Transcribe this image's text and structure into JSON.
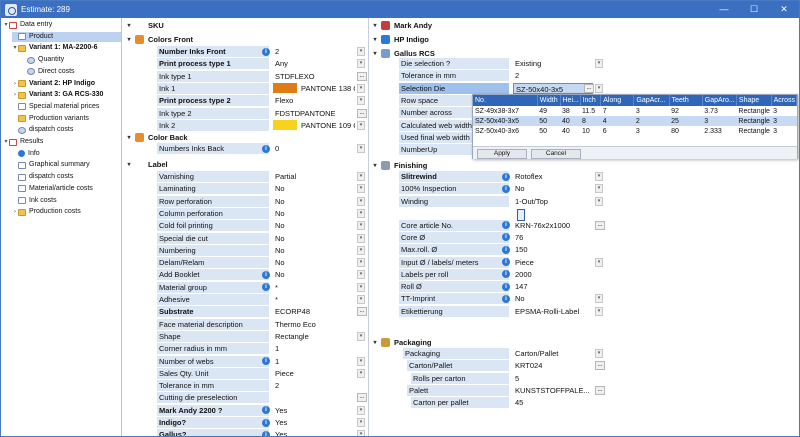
{
  "window": {
    "title": "Estimate: 289",
    "controls": [
      "—",
      "☐",
      "✕"
    ]
  },
  "tree": [
    {
      "label": "Data entry",
      "indent": 0,
      "icon": "grid",
      "exp": "▾",
      "bold": false
    },
    {
      "label": "Product",
      "indent": 1,
      "icon": "doc",
      "exp": "",
      "bold": false,
      "sel": true
    },
    {
      "label": "Variant 1: MA-2200-6",
      "indent": 1,
      "icon": "folder",
      "exp": "▾",
      "bold": true
    },
    {
      "label": "Quantity",
      "indent": 2,
      "icon": "cog",
      "exp": "",
      "bold": false
    },
    {
      "label": "Direct costs",
      "indent": 2,
      "icon": "cog",
      "exp": "",
      "bold": false
    },
    {
      "label": "Variant 2: HP Indigo",
      "indent": 1,
      "icon": "folder",
      "exp": "›",
      "bold": true
    },
    {
      "label": "Variant 3: GA RCS-330",
      "indent": 1,
      "icon": "folder",
      "exp": "›",
      "bold": true
    },
    {
      "label": "Special material prices",
      "indent": 1,
      "icon": "doc",
      "exp": "",
      "bold": false
    },
    {
      "label": "Production variants",
      "indent": 1,
      "icon": "folder",
      "exp": "",
      "bold": false
    },
    {
      "label": "dispatch costs",
      "indent": 1,
      "icon": "cog",
      "exp": "",
      "bold": false
    },
    {
      "label": "Results",
      "indent": 0,
      "icon": "grid",
      "exp": "▾",
      "bold": false
    },
    {
      "label": "Info",
      "indent": 1,
      "icon": "info",
      "exp": "",
      "bold": false
    },
    {
      "label": "Graphical summary",
      "indent": 1,
      "icon": "doc",
      "exp": "",
      "bold": false
    },
    {
      "label": "dispatch costs",
      "indent": 1,
      "icon": "doc",
      "exp": "",
      "bold": false
    },
    {
      "label": "Material/article costs",
      "indent": 1,
      "icon": "doc",
      "exp": "",
      "bold": false
    },
    {
      "label": "Ink costs",
      "indent": 1,
      "icon": "doc",
      "exp": "",
      "bold": false
    },
    {
      "label": "Production costs",
      "indent": 1,
      "icon": "folder",
      "exp": "›",
      "bold": false
    }
  ],
  "middle": {
    "sku_header": "SKU",
    "colors_front_header": "Colors Front",
    "colors_front": [
      {
        "label": "Number Inks Front",
        "value": "2",
        "bold": true,
        "info": true,
        "dd": true
      },
      {
        "label": "Print process type 1",
        "value": "Any",
        "bold": true,
        "info": false,
        "dd": true
      },
      {
        "label": "Ink type 1",
        "value": "STDFLEXO",
        "bold": false,
        "info": false,
        "dots": true
      },
      {
        "label": "Ink 1",
        "value": "PANTONE 138 C",
        "bold": false,
        "info": false,
        "dd": true,
        "swatch": "#e07c16"
      },
      {
        "label": "Print process type 2",
        "value": "Flexo",
        "bold": true,
        "info": false,
        "dd": true
      },
      {
        "label": "Ink type 2",
        "value": "FDSTDPANTONE",
        "bold": false,
        "info": false,
        "dots": true
      },
      {
        "label": "Ink 2",
        "value": "PANTONE 109 C",
        "bold": false,
        "info": false,
        "dd": true,
        "swatch": "#f7d31e"
      }
    ],
    "color_back_header": "Color Back",
    "color_back": [
      {
        "label": "Numbers Inks Back",
        "value": "0",
        "bold": false,
        "info": true,
        "dd": true
      }
    ],
    "label_header": "Label",
    "label": [
      {
        "label": "Varnishing",
        "value": "Partial",
        "bold": false,
        "info": false,
        "dd": true
      },
      {
        "label": "Laminating",
        "value": "No",
        "bold": false,
        "info": false,
        "dd": true
      },
      {
        "label": "Row perforation",
        "value": "No",
        "bold": false,
        "info": false,
        "dd": true
      },
      {
        "label": "Column perforation",
        "value": "No",
        "bold": false,
        "info": false,
        "dd": true
      },
      {
        "label": "Cold foil printing",
        "value": "No",
        "bold": false,
        "info": false,
        "dd": true
      },
      {
        "label": "Special die cut",
        "value": "No",
        "bold": false,
        "info": false,
        "dd": true
      },
      {
        "label": "Numbering",
        "value": "No",
        "bold": false,
        "info": false,
        "dd": true
      },
      {
        "label": "Delam/Relam",
        "value": "No",
        "bold": false,
        "info": false,
        "dd": true
      },
      {
        "label": "Add Booklet",
        "value": "No",
        "bold": false,
        "info": true,
        "dd": true
      },
      {
        "label": "Material group",
        "value": "*",
        "bold": false,
        "info": true,
        "dd": true
      },
      {
        "label": "Adhesive",
        "value": "*",
        "bold": false,
        "info": false,
        "dd": true
      },
      {
        "label": "Substrate",
        "value": "ECORP48",
        "bold": true,
        "info": false,
        "dots": true
      },
      {
        "label": "Face material description",
        "value": "Thermo Eco",
        "bold": false,
        "info": false
      },
      {
        "label": "Shape",
        "value": "Rectangle",
        "bold": false,
        "info": false,
        "dd": true
      },
      {
        "label": "Corner radius in mm",
        "value": "1",
        "bold": false,
        "info": false
      },
      {
        "label": "Number of webs",
        "value": "1",
        "bold": false,
        "info": true,
        "dd": true
      },
      {
        "label": "Sales Qty. Unit",
        "value": "Piece",
        "bold": false,
        "info": false,
        "dd": true
      },
      {
        "label": "Tolerance in mm",
        "value": "2",
        "bold": false,
        "info": false
      },
      {
        "label": "Cutting die preselection",
        "value": "",
        "bold": false,
        "info": false,
        "dots": true
      },
      {
        "label": "Mark Andy 2200 ?",
        "value": "Yes",
        "bold": true,
        "info": true,
        "dd": true
      },
      {
        "label": "Indigo?",
        "value": "Yes",
        "bold": true,
        "info": true,
        "dd": true
      },
      {
        "label": "Gallus?",
        "value": "Yes",
        "bold": true,
        "info": true,
        "dd": true
      }
    ]
  },
  "right": {
    "mark_andy": "Mark Andy",
    "hp_indigo": "HP Indigo",
    "gallus": "Gallus RCS",
    "gallus_rows": [
      {
        "label": "Die selection ?",
        "value": "Existing",
        "info": false,
        "dd": true,
        "hl": false
      },
      {
        "label": "Tolerance in mm",
        "value": "2",
        "info": false,
        "hl": false
      },
      {
        "label": "Selection Die",
        "value": "SZ-50x40-3x5",
        "info": false,
        "dd": true,
        "dots": true,
        "hl": true
      },
      {
        "label": "Row space",
        "value": "",
        "info": false,
        "hl": false
      },
      {
        "label": "Number across",
        "value": "",
        "info": false,
        "hl": false
      },
      {
        "label": "Calculated web width",
        "value": "",
        "info": false,
        "hl": false
      },
      {
        "label": "Used final web width",
        "value": "",
        "info": false,
        "hl": false
      },
      {
        "label": "NumberUp",
        "value": "",
        "info": false,
        "hl": false
      }
    ],
    "finishing": "Finishing",
    "finishing_rows": [
      {
        "label": "Slitrewind",
        "value": "Rotoflex",
        "bold": true,
        "info": true,
        "dd": true
      },
      {
        "label": "100% Inspection",
        "value": "No",
        "info": true,
        "dd": true
      },
      {
        "label": "Winding",
        "value": "1-Out/Top",
        "info": false,
        "dd": true,
        "tall": true
      },
      {
        "label": "Core article No.",
        "value": "KRN-76x2x1000",
        "info": true,
        "dots": true
      },
      {
        "label": "Core Ø",
        "value": "76",
        "info": true
      },
      {
        "label": "Max.roll. Ø",
        "value": "150",
        "info": true
      },
      {
        "label": "Input Ø / labels/ meters",
        "value": "Piece",
        "info": true,
        "dd": true
      },
      {
        "label": "Labels per roll",
        "value": "2000",
        "info": true
      },
      {
        "label": "Roll Ø",
        "value": "147",
        "info": true
      },
      {
        "label": "TT-Imprint",
        "value": "No",
        "info": true,
        "dd": true
      },
      {
        "label": "Etikettierung",
        "value": "EPSMA-Rolli-Label",
        "info": false,
        "dd": true
      }
    ],
    "packaging": "Packaging",
    "packaging_rows": [
      {
        "label": "Packaging",
        "value": "Carton/Pallet",
        "indent": 1,
        "dd": true
      },
      {
        "label": "Carton/Pallet",
        "value": "KRT024",
        "indent": 2,
        "dots": true
      },
      {
        "label": "Rolls per carton",
        "value": "5",
        "indent": 3
      },
      {
        "label": "Palett",
        "value": "KUNSTSTOFFPALE...",
        "indent": 2,
        "dots": true
      },
      {
        "label": "Carton per pallet",
        "value": "45",
        "indent": 3
      }
    ]
  },
  "popup": {
    "headers": [
      "No.",
      "Width",
      "Hei...",
      "Inch",
      "Along",
      "GapAcr...",
      "Teeth",
      "GapAro...",
      "Shape",
      "Across"
    ],
    "rows": [
      [
        "SZ-49x38-3x7",
        "49",
        "38",
        "11.5",
        "7",
        "3",
        "92",
        "3.73",
        "Rectangle",
        "3"
      ],
      [
        "SZ-50x40-3x5",
        "50",
        "40",
        "8",
        "4",
        "2",
        "25",
        "3",
        "Rectangle",
        "3"
      ],
      [
        "SZ-50x40-3x6",
        "50",
        "40",
        "10",
        "6",
        "3",
        "80",
        "2.333",
        "Rectangle",
        "3"
      ]
    ],
    "apply": "Apply",
    "cancel": "Cancel"
  }
}
